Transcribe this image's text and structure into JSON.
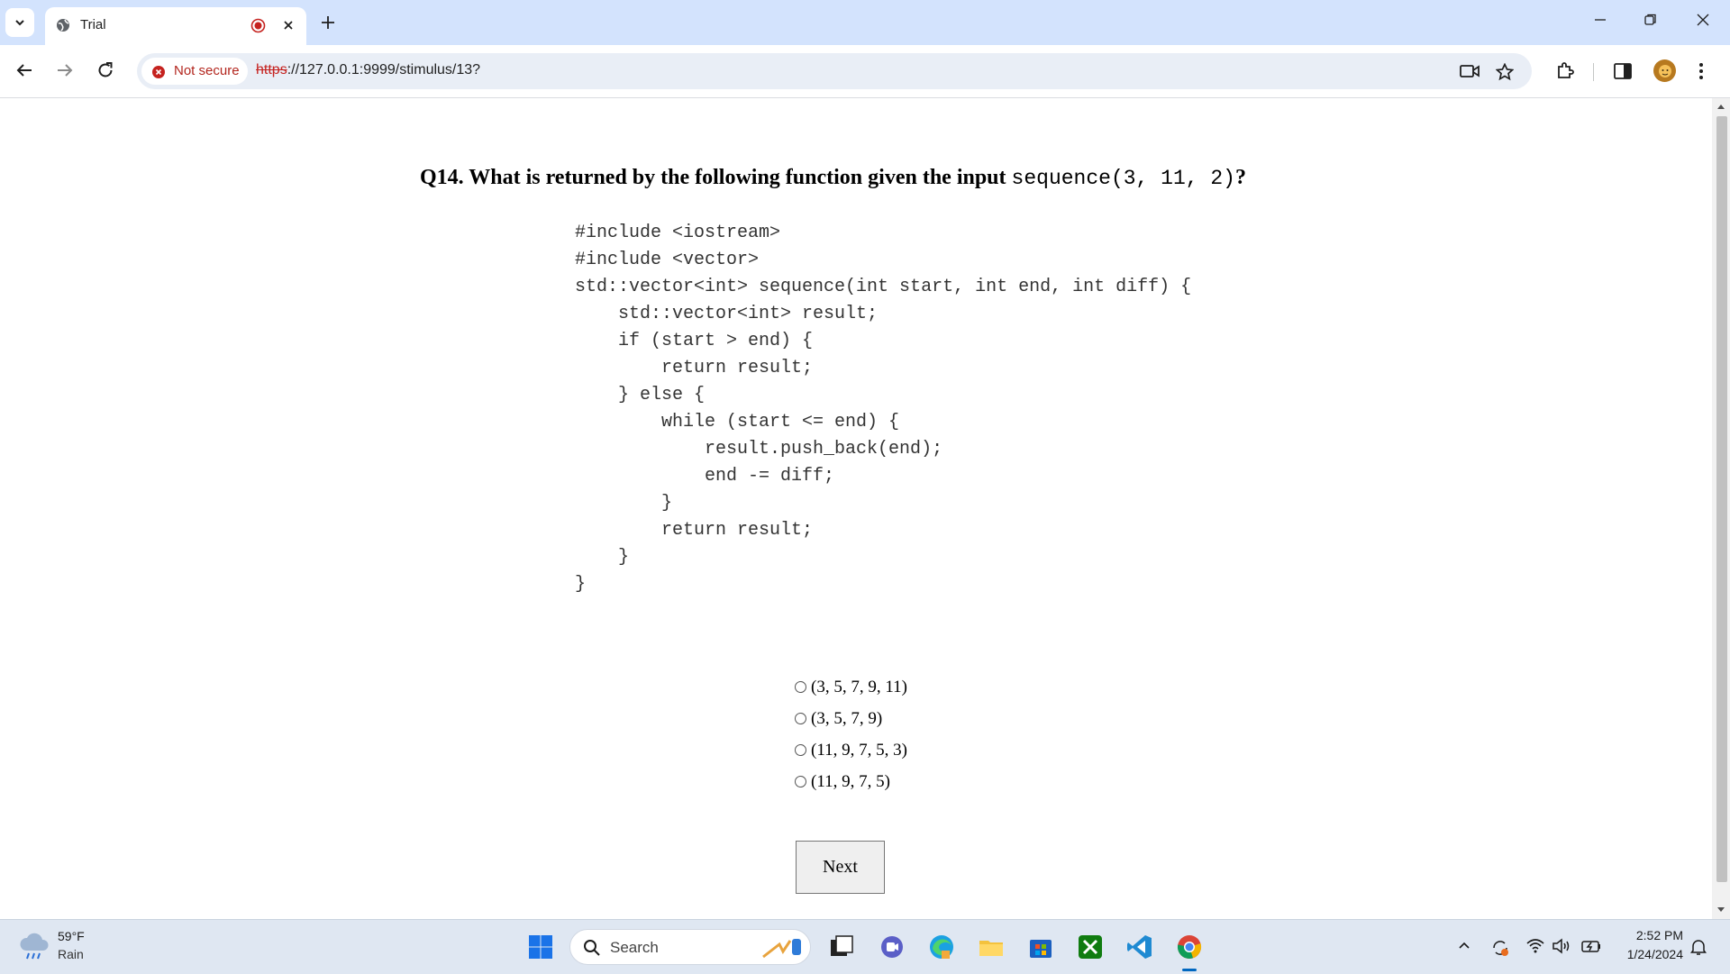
{
  "browser": {
    "tab_title": "Trial",
    "address": {
      "security_label": "Not secure",
      "url_scheme": "https",
      "url_rest": "://127.0.0.1:9999/stimulus/13?"
    }
  },
  "page": {
    "question_text": "Q14. What is returned by the following function given the input ",
    "question_code": "sequence(3, 11, 2)",
    "question_end": "?",
    "code_lines": [
      "#include <iostream>",
      "#include <vector>",
      "std::vector<int> sequence(int start, int end, int diff) {",
      "    std::vector<int> result;",
      "    if (start > end) {",
      "        return result;",
      "    } else {",
      "        while (start <= end) {",
      "            result.push_back(end);",
      "            end -= diff;",
      "        }",
      "        return result;",
      "    }",
      "}"
    ],
    "options": [
      "(3, 5, 7, 9, 11)",
      "(3, 5, 7, 9)",
      "(11, 9, 7, 5, 3)",
      "(11, 9, 7, 5)"
    ],
    "next_label": "Next"
  },
  "taskbar": {
    "weather_temp": "59°F",
    "weather_desc": "Rain",
    "search_label": "Search",
    "time": "2:52 PM",
    "date": "1/24/2024"
  }
}
